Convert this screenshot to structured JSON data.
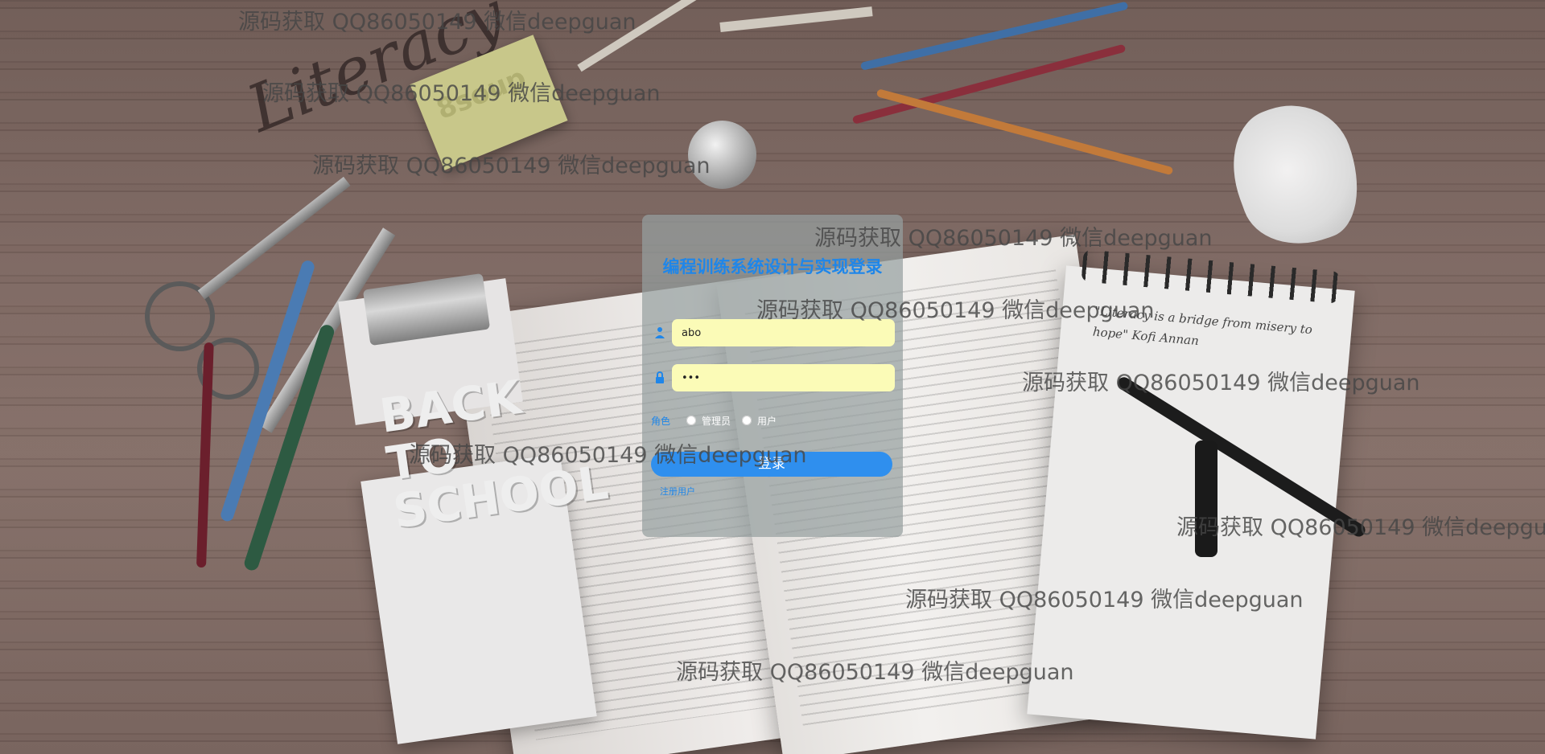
{
  "login": {
    "title": "编程训练系统设计与实现登录",
    "username_value": "abo",
    "password_value": "•••",
    "role_label": "角色",
    "role_options": [
      "管理员",
      "用户"
    ],
    "login_button": "登录",
    "register_link": "注册用户"
  },
  "background": {
    "notepad_text": "\"Literacy is a bridge from misery to hope\" Kofi Annan",
    "sticky_text": "8soup",
    "back_text": "BACK TO SCHOOL",
    "literacy_text": "Literacy"
  },
  "watermark": {
    "text": "源码获取 QQ86050149 微信deepguan"
  },
  "colors": {
    "accent": "#1f86e9",
    "button": "#2f8fee",
    "input_bg": "#fbfbb7",
    "panel_bg": "rgba(150,160,160,0.72)"
  },
  "icons": {
    "username": "user-icon",
    "password": "lock-icon"
  }
}
